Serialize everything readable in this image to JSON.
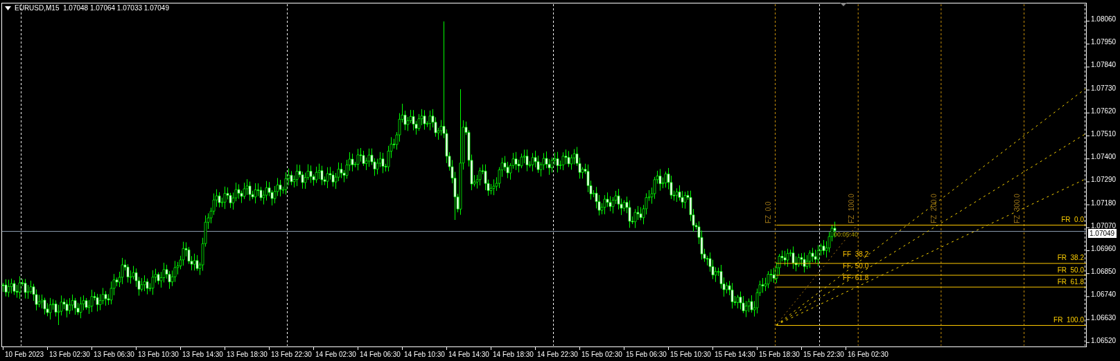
{
  "chart": {
    "header": "EURUSD,M15  1.07048 1.07064 1.07033 1.07049",
    "price_axis": [
      "1.08060",
      "1.07950",
      "1.07840",
      "1.07730",
      "1.07620",
      "1.07510",
      "1.07400",
      "1.07290",
      "1.07180",
      "1.07070",
      "1.06960",
      "1.06850",
      "1.06740",
      "1.06630",
      "1.06520"
    ],
    "current_price": "1.07049",
    "time_axis": [
      "10 Feb 2023",
      "13 Feb 02:30",
      "13 Feb 06:30",
      "13 Feb 10:30",
      "13 Feb 14:30",
      "13 Feb 18:30",
      "13 Feb 22:30",
      "14 Feb 02:30",
      "14 Feb 06:30",
      "14 Feb 10:30",
      "14 Feb 14:30",
      "14 Feb 18:30",
      "14 Feb 22:30",
      "15 Feb 02:30",
      "15 Feb 06:30",
      "15 Feb 10:30",
      "15 Feb 14:30",
      "15 Feb 18:30",
      "15 Feb 22:30",
      "16 Feb 02:30"
    ],
    "countdown": "00:05:40",
    "fib_retracement": [
      "FR  0.0",
      "FR  38.2",
      "FR  50.0",
      "FR  61.8",
      "FR  100.0"
    ],
    "fib_fan": [
      "FF  38.2",
      "FF  50.0",
      "FF  61.8"
    ],
    "fib_zones": [
      "FZ  0.0",
      "FZ  100.0",
      "FZ  200.0",
      "FZ  300.0"
    ]
  }
}
